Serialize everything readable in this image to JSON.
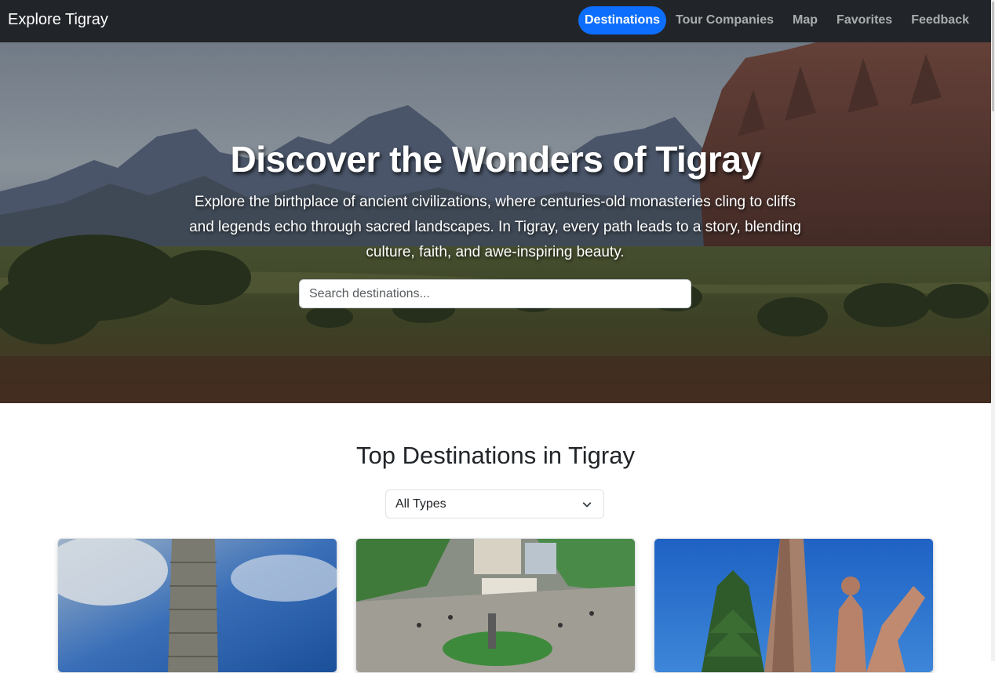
{
  "navbar": {
    "brand": "Explore Tigray",
    "links": [
      {
        "label": "Destinations",
        "active": true
      },
      {
        "label": "Tour Companies",
        "active": false
      },
      {
        "label": "Map",
        "active": false
      },
      {
        "label": "Favorites",
        "active": false
      },
      {
        "label": "Feedback",
        "active": false
      }
    ]
  },
  "hero": {
    "title": "Discover the Wonders of Tigray",
    "text": "Explore the birthplace of ancient civilizations, where centuries-old monasteries cling to cliffs and legends echo through sacred landscapes. In Tigray, every path leads to a story, blending culture, faith, and awe-inspiring beauty.",
    "search_placeholder": "Search destinations..."
  },
  "section": {
    "title": "Top Destinations in Tigray",
    "filter_value": "All Types"
  },
  "colors": {
    "navbar_bg": "#212529",
    "accent": "#0d6efd"
  }
}
